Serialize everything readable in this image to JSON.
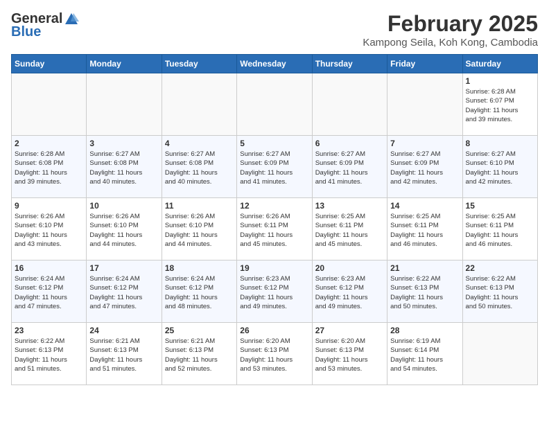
{
  "header": {
    "logo_general": "General",
    "logo_blue": "Blue",
    "title": "February 2025",
    "subtitle": "Kampong Seila, Koh Kong, Cambodia"
  },
  "weekdays": [
    "Sunday",
    "Monday",
    "Tuesday",
    "Wednesday",
    "Thursday",
    "Friday",
    "Saturday"
  ],
  "weeks": [
    [
      {
        "day": "",
        "info": ""
      },
      {
        "day": "",
        "info": ""
      },
      {
        "day": "",
        "info": ""
      },
      {
        "day": "",
        "info": ""
      },
      {
        "day": "",
        "info": ""
      },
      {
        "day": "",
        "info": ""
      },
      {
        "day": "1",
        "info": "Sunrise: 6:28 AM\nSunset: 6:07 PM\nDaylight: 11 hours\nand 39 minutes."
      }
    ],
    [
      {
        "day": "2",
        "info": "Sunrise: 6:28 AM\nSunset: 6:08 PM\nDaylight: 11 hours\nand 39 minutes."
      },
      {
        "day": "3",
        "info": "Sunrise: 6:27 AM\nSunset: 6:08 PM\nDaylight: 11 hours\nand 40 minutes."
      },
      {
        "day": "4",
        "info": "Sunrise: 6:27 AM\nSunset: 6:08 PM\nDaylight: 11 hours\nand 40 minutes."
      },
      {
        "day": "5",
        "info": "Sunrise: 6:27 AM\nSunset: 6:09 PM\nDaylight: 11 hours\nand 41 minutes."
      },
      {
        "day": "6",
        "info": "Sunrise: 6:27 AM\nSunset: 6:09 PM\nDaylight: 11 hours\nand 41 minutes."
      },
      {
        "day": "7",
        "info": "Sunrise: 6:27 AM\nSunset: 6:09 PM\nDaylight: 11 hours\nand 42 minutes."
      },
      {
        "day": "8",
        "info": "Sunrise: 6:27 AM\nSunset: 6:10 PM\nDaylight: 11 hours\nand 42 minutes."
      }
    ],
    [
      {
        "day": "9",
        "info": "Sunrise: 6:26 AM\nSunset: 6:10 PM\nDaylight: 11 hours\nand 43 minutes."
      },
      {
        "day": "10",
        "info": "Sunrise: 6:26 AM\nSunset: 6:10 PM\nDaylight: 11 hours\nand 44 minutes."
      },
      {
        "day": "11",
        "info": "Sunrise: 6:26 AM\nSunset: 6:10 PM\nDaylight: 11 hours\nand 44 minutes."
      },
      {
        "day": "12",
        "info": "Sunrise: 6:26 AM\nSunset: 6:11 PM\nDaylight: 11 hours\nand 45 minutes."
      },
      {
        "day": "13",
        "info": "Sunrise: 6:25 AM\nSunset: 6:11 PM\nDaylight: 11 hours\nand 45 minutes."
      },
      {
        "day": "14",
        "info": "Sunrise: 6:25 AM\nSunset: 6:11 PM\nDaylight: 11 hours\nand 46 minutes."
      },
      {
        "day": "15",
        "info": "Sunrise: 6:25 AM\nSunset: 6:11 PM\nDaylight: 11 hours\nand 46 minutes."
      }
    ],
    [
      {
        "day": "16",
        "info": "Sunrise: 6:24 AM\nSunset: 6:12 PM\nDaylight: 11 hours\nand 47 minutes."
      },
      {
        "day": "17",
        "info": "Sunrise: 6:24 AM\nSunset: 6:12 PM\nDaylight: 11 hours\nand 47 minutes."
      },
      {
        "day": "18",
        "info": "Sunrise: 6:24 AM\nSunset: 6:12 PM\nDaylight: 11 hours\nand 48 minutes."
      },
      {
        "day": "19",
        "info": "Sunrise: 6:23 AM\nSunset: 6:12 PM\nDaylight: 11 hours\nand 49 minutes."
      },
      {
        "day": "20",
        "info": "Sunrise: 6:23 AM\nSunset: 6:12 PM\nDaylight: 11 hours\nand 49 minutes."
      },
      {
        "day": "21",
        "info": "Sunrise: 6:22 AM\nSunset: 6:13 PM\nDaylight: 11 hours\nand 50 minutes."
      },
      {
        "day": "22",
        "info": "Sunrise: 6:22 AM\nSunset: 6:13 PM\nDaylight: 11 hours\nand 50 minutes."
      }
    ],
    [
      {
        "day": "23",
        "info": "Sunrise: 6:22 AM\nSunset: 6:13 PM\nDaylight: 11 hours\nand 51 minutes."
      },
      {
        "day": "24",
        "info": "Sunrise: 6:21 AM\nSunset: 6:13 PM\nDaylight: 11 hours\nand 51 minutes."
      },
      {
        "day": "25",
        "info": "Sunrise: 6:21 AM\nSunset: 6:13 PM\nDaylight: 11 hours\nand 52 minutes."
      },
      {
        "day": "26",
        "info": "Sunrise: 6:20 AM\nSunset: 6:13 PM\nDaylight: 11 hours\nand 53 minutes."
      },
      {
        "day": "27",
        "info": "Sunrise: 6:20 AM\nSunset: 6:13 PM\nDaylight: 11 hours\nand 53 minutes."
      },
      {
        "day": "28",
        "info": "Sunrise: 6:19 AM\nSunset: 6:14 PM\nDaylight: 11 hours\nand 54 minutes."
      },
      {
        "day": "",
        "info": ""
      }
    ]
  ]
}
